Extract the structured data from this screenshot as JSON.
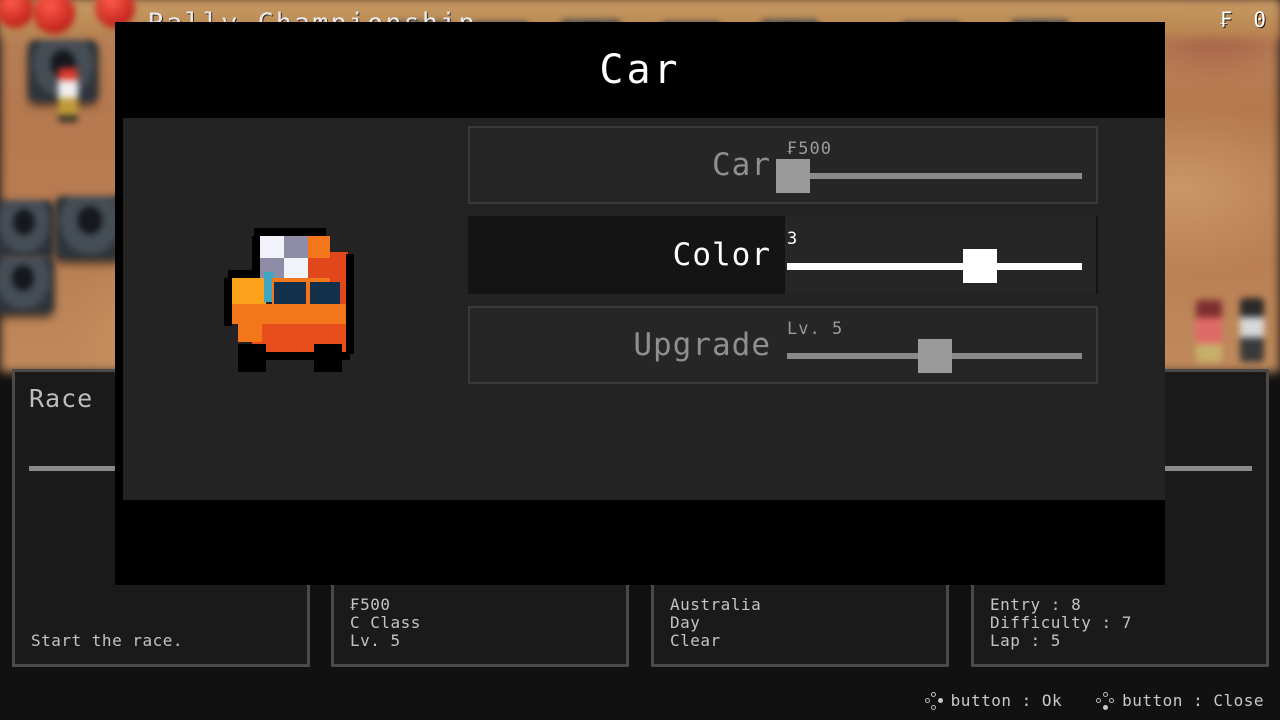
{
  "hud": {
    "currency_symbol": "₣",
    "money": "0",
    "background_title": "Rally Championship"
  },
  "modal": {
    "title": "Car",
    "preview_label": "car-sprite",
    "rows": [
      {
        "label": "Car",
        "value": "₣500",
        "fill": 0.02,
        "active": false,
        "name": "car"
      },
      {
        "label": "Color",
        "value": "3",
        "fill": 0.655,
        "active": true,
        "name": "color"
      },
      {
        "label": "Upgrade",
        "value": "Lv. 5",
        "fill": 0.5,
        "active": false,
        "name": "upgrade"
      }
    ]
  },
  "cards": [
    {
      "title": "Race",
      "lines": [
        "Start the race."
      ]
    },
    {
      "title": "",
      "lines": [
        "₣500",
        "C Class",
        "Lv. 5"
      ]
    },
    {
      "title": "",
      "lines": [
        "Australia",
        "Day",
        "Clear"
      ]
    },
    {
      "title": "",
      "lines": [
        "Entry : 8",
        "Difficulty : 7",
        "Lap : 5"
      ]
    }
  ],
  "hints": [
    {
      "label": "button : Ok",
      "button": "right"
    },
    {
      "label": "button : Close",
      "button": "bottom"
    }
  ],
  "colors": {
    "car_body": "#f4761b",
    "car_body_dark": "#e0481c",
    "car_window": "#123049",
    "accent_white": "#ffffff",
    "panel": "#232323",
    "card_bg": "#1a1a1a",
    "card_border": "#4a4a4a"
  }
}
